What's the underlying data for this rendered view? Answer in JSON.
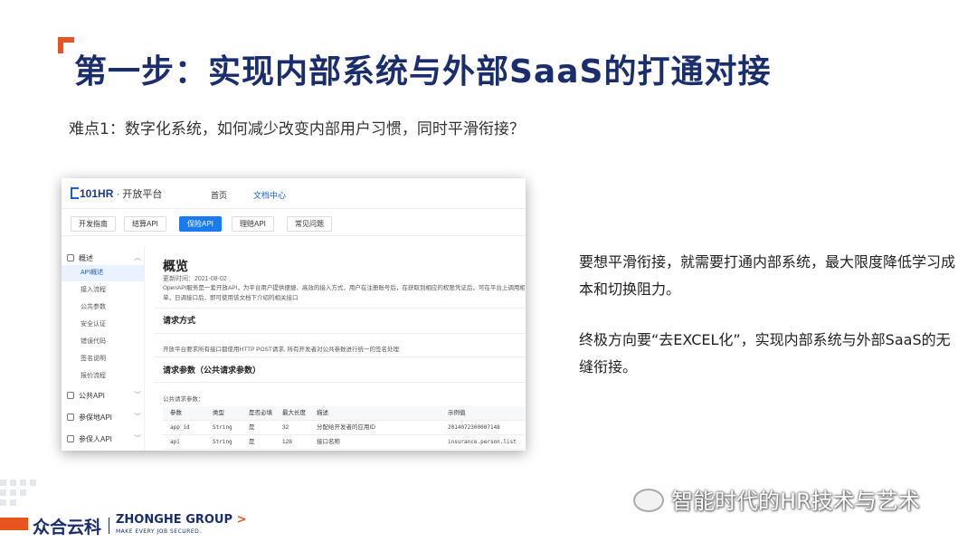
{
  "slide": {
    "title": "第一步：实现内部系统与外部SaaS的打通对接",
    "subtitle": "难点1：数字化系统，如何减少改变内部用户习惯，同时平滑衔接？",
    "paragraph1": "要想平滑衔接，就需要打通内部系统，最大限度降低学习成本和切换阻力。",
    "paragraph2": "终极方向要“去EXCEL化”，实现内部系统与外部SaaS的无缝衔接。",
    "watermark": "智能时代的HR技术与艺术",
    "accent_color": "#e8541f",
    "title_color": "#1a2e6e"
  },
  "brand": {
    "cn": "众合云科",
    "en": "ZHONGHE GROUP",
    "arrow": ">",
    "tagline": "MAKE EVERY JOB SECURED."
  },
  "screenshot": {
    "logo": "101HR",
    "logo_suffix": "· 开放平台",
    "nav": [
      "首页",
      "文档中心"
    ],
    "tabs": [
      "开发指南",
      "结算API",
      "保险API",
      "理赔API",
      "常见问题"
    ],
    "active_tab": "保险API",
    "sidebar": {
      "overview": "概述",
      "items": [
        "API概述",
        "接入流程",
        "公共参数",
        "安全认证",
        "错误代码",
        "签名说明",
        "报价流程"
      ],
      "groups": [
        "公共API",
        "参保地API",
        "参保人API"
      ]
    },
    "content": {
      "title": "概览",
      "date": "更新时间：2021-08-02",
      "desc1": "OpenAPI服务是一套开放API，为平台用户提供便捷、高效的接入方式，用户在注册账号后，在获取到相应的权限凭证后，可在平台上调用相应的API接口。",
      "desc2": "单，日调接口后，即可使用该文档下介绍的相关接口",
      "h1": "请求方式",
      "t1": "开放平台要求所有接口都使用HTTP POST请求, 所有开发者对公共参数进行统一的签名处理",
      "h2": "请求参数（公共请求参数）",
      "t2": "公共请求参数：",
      "table": {
        "headers": [
          "参数",
          "类型",
          "是否必填",
          "最大长度",
          "描述",
          "示例值"
        ],
        "rows": [
          [
            "app_id",
            "String",
            "是",
            "32",
            "分配给开发者的应用ID",
            "2014072300007148"
          ],
          [
            "api",
            "String",
            "是",
            "128",
            "接口名称",
            "insurance.person.list"
          ]
        ]
      }
    }
  }
}
